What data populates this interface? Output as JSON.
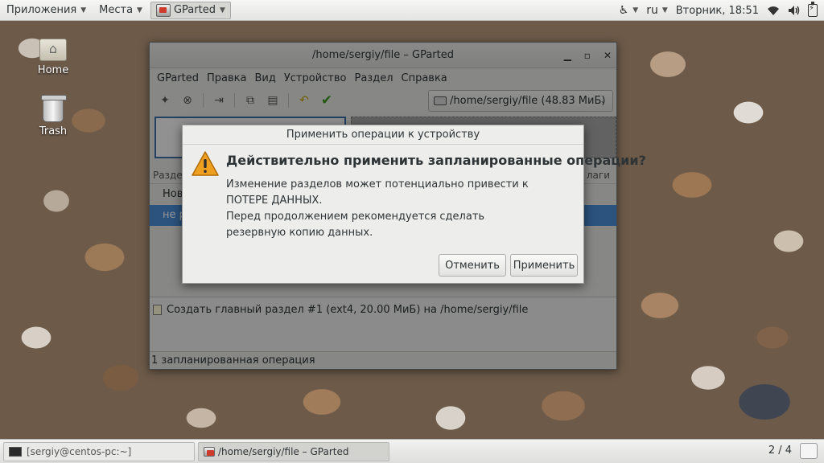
{
  "top_panel": {
    "applications": "Приложения",
    "places": "Места",
    "active_app": "GParted",
    "language": "ru",
    "clock": "Вторник, 18:51"
  },
  "desktop": {
    "icons": [
      {
        "label": "Home",
        "icon": "home-folder-icon"
      },
      {
        "label": "Trash",
        "icon": "trash-icon"
      }
    ]
  },
  "window": {
    "title": "/home/sergiy/file – GParted",
    "menu": [
      "GParted",
      "Правка",
      "Вид",
      "Устройство",
      "Раздел",
      "Справка"
    ],
    "device_selector": "/home/sergiy/file  (48.83 МиБ)",
    "table": {
      "header_left": "Разде",
      "header_right": "лаги",
      "rows": [
        "Нов",
        "не р"
      ]
    },
    "pending_operation": "Создать главный раздел #1 (ext4, 20.00 МиБ) на /home/sergiy/file",
    "status": "1 запланированная операция"
  },
  "dialog": {
    "title": "Применить операции к устройству",
    "heading": "Действительно применить запланированные операции?",
    "body_lines": [
      "Изменение разделов может потенциально привести к",
      "ПОТЕРЕ ДАННЫХ.",
      "Перед продолжением рекомендуется сделать",
      "резервную копию данных."
    ],
    "cancel": "Отменить",
    "apply": "Применить"
  },
  "taskbar": {
    "tasks": [
      "[sergiy@centos-pc:~]",
      "/home/sergiy/file – GParted"
    ],
    "workspace": "2 / 4"
  },
  "colors": {
    "selection": "#4a90d9",
    "warning": "#f0a020",
    "partition_border": "#3d6da8"
  }
}
